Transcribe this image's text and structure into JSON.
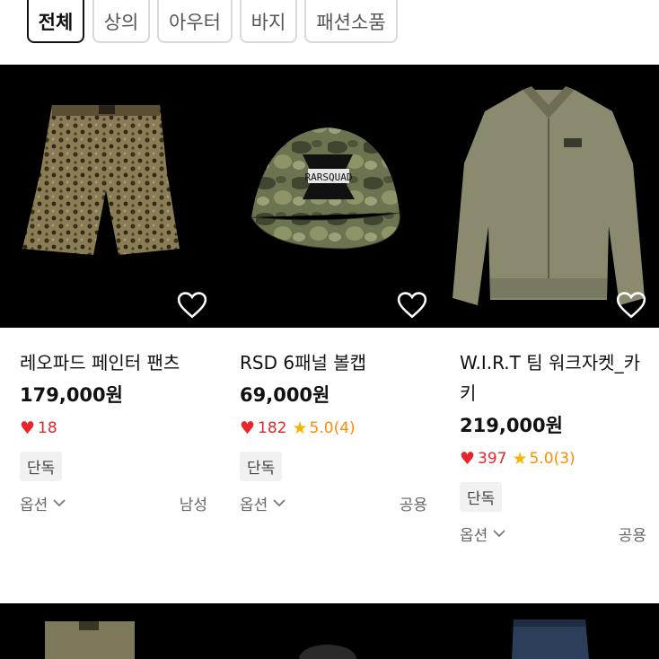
{
  "tabs": [
    "전체",
    "상의",
    "아우터",
    "바지",
    "패션소품"
  ],
  "products": [
    {
      "title": "레오파드 페인터 팬츠",
      "price": "179,000원",
      "likes": "18",
      "rating": "",
      "badge": "단독",
      "option_label": "옵션",
      "gender": "남성"
    },
    {
      "title": "RSD 6패널 볼캡",
      "price": "69,000원",
      "likes": "182",
      "rating": "5.0(4)",
      "badge": "단독",
      "option_label": "옵션",
      "gender": "공용"
    },
    {
      "title": "W.I.R.T 팀 워크자켓_카키",
      "price": "219,000원",
      "likes": "397",
      "rating": "5.0(3)",
      "badge": "단독",
      "option_label": "옵션",
      "gender": "공용"
    }
  ],
  "cap_logo_text": "RARSQUAD",
  "colors": {
    "like": "#e8242d",
    "star": "#f5b400",
    "rating": "#ff8a00"
  }
}
